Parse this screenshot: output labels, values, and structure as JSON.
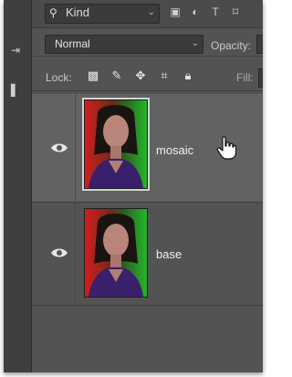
{
  "filter": {
    "kind_label": "Kind",
    "icons": [
      "search-icon",
      "image-filter-icon",
      "adjustment-filter-icon",
      "type-filter-icon",
      "shape-filter-icon"
    ]
  },
  "blend": {
    "mode": "Normal",
    "opacity_label": "Opacity:"
  },
  "lock": {
    "label": "Lock:",
    "icons": [
      "lock-transparent-pixels-icon",
      "lock-image-pixels-icon",
      "lock-position-icon",
      "lock-artboard-icon",
      "lock-all-icon"
    ],
    "fill_label": "Fill:"
  },
  "layers": [
    {
      "name": "mosaic",
      "visible": true,
      "selected": true
    },
    {
      "name": "base",
      "visible": true,
      "selected": false
    }
  ],
  "colors": {
    "panel_bg": "#535353",
    "selected_row_bg": "#626262",
    "text": "#f0f0f0"
  }
}
